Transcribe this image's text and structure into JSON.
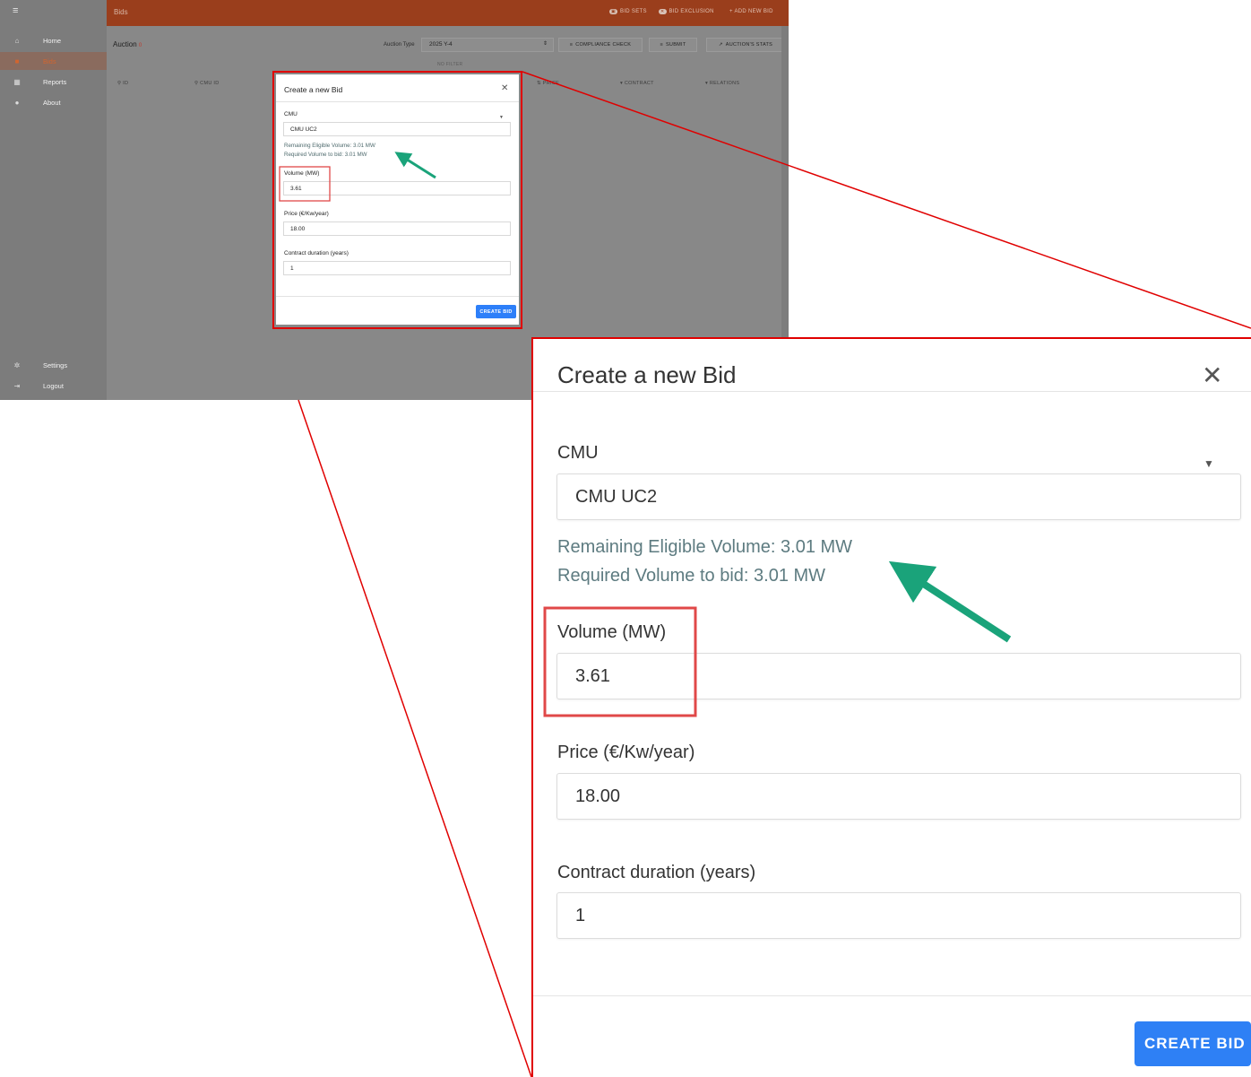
{
  "sidebar": {
    "items": [
      {
        "icon": "home-icon",
        "label": "Home"
      },
      {
        "icon": "bids-icon",
        "label": "Bids"
      },
      {
        "icon": "reports-icon",
        "label": "Reports"
      },
      {
        "icon": "info-icon",
        "label": "About"
      }
    ],
    "bottom_items": [
      {
        "icon": "gear-icon",
        "label": "Settings"
      },
      {
        "icon": "logout-icon",
        "label": "Logout"
      }
    ]
  },
  "topbar": {
    "title": "Bids",
    "actions": {
      "bid_sets": "BID SETS",
      "bid_exclusion": "BID EXCLUSION",
      "add_new_bid": "+ ADD NEW BID"
    }
  },
  "toolbar": {
    "auction_label": "Auction",
    "auction_count": "0",
    "auction_type_label": "Auction Type",
    "auction_type_value": "2025 Y-4",
    "compliance_check": "COMPLIANCE CHECK",
    "submit": "SUBMIT",
    "auction_stats": "AUCTION'S STATS",
    "no_filter": "NO FILTER"
  },
  "table": {
    "columns": [
      "ID",
      "CMU ID",
      "PRICE",
      "CONTRACT",
      "RELATIONS"
    ]
  },
  "modal": {
    "title": "Create a new Bid",
    "cmu_label": "CMU",
    "cmu_value": "CMU UC2",
    "remaining_volume": "Remaining Eligible Volume: 3.01 MW",
    "required_volume": "Required Volume to bid: 3.01 MW",
    "volume_label": "Volume (MW)",
    "volume_value": "3.61",
    "price_label": "Price (€/Kw/year)",
    "price_value": "18.00",
    "duration_label": "Contract duration (years)",
    "duration_value": "1",
    "create_button": "CREATE BID"
  },
  "colors": {
    "topbar": "#9a3e1c",
    "active_menu": "#d2652f",
    "primary_button": "#2e80f5",
    "highlight_box": "#e53935",
    "arrow": "#1aa37a"
  }
}
